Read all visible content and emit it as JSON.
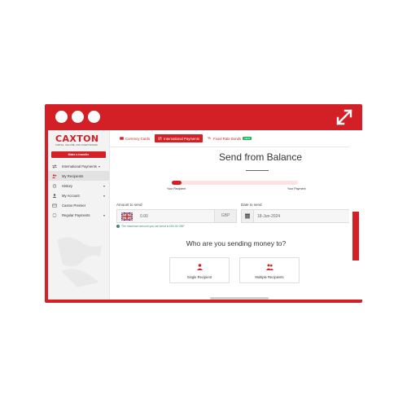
{
  "brand": {
    "name": "CAXTON",
    "tagline": "SIMPLE, SECURE, AND EVERYWHERE",
    "accent_color": "#d32027"
  },
  "sidebar": {
    "primary_action": "Make a transfer",
    "items": [
      {
        "label": "International Payments",
        "icon": "transfer-icon",
        "has_chevron": true,
        "active": false
      },
      {
        "label": "My Recipients",
        "icon": "users-icon",
        "has_chevron": false,
        "active": true
      },
      {
        "label": "History",
        "icon": "history-icon",
        "has_chevron": true,
        "active": false
      },
      {
        "label": "My Account",
        "icon": "account-icon",
        "has_chevron": true,
        "active": false
      },
      {
        "label": "Caxton Premier",
        "icon": "card-icon",
        "has_chevron": false,
        "active": false
      },
      {
        "label": "Regular Payments",
        "icon": "repeat-icon",
        "has_chevron": true,
        "active": false
      }
    ]
  },
  "tabs": [
    {
      "label": "Currency Cards",
      "icon": "card-icon",
      "active": false
    },
    {
      "label": "International Payments",
      "icon": "transfer-icon",
      "active": true
    },
    {
      "label": "Fixed Rate Bonds",
      "icon": "percent-icon",
      "active": false,
      "badge": "NEW"
    }
  ],
  "main": {
    "title": "Send from Balance",
    "progress": {
      "fraction": 0.08,
      "step_left": "Your Recipient",
      "step_right": "Your Payment"
    },
    "amount_label": "Amount to send",
    "amount_value": "0.00",
    "currency": "GBP",
    "hint": "The maximum amount you can send is £50.00 GBP",
    "date_label": "Date to send",
    "date_value": "18-Jun-2024",
    "question": "Who are you sending money to?",
    "options": [
      {
        "label": "Single Recipient",
        "icon": "person-icon"
      },
      {
        "label": "Multiple Recipients",
        "icon": "people-icon"
      }
    ]
  }
}
